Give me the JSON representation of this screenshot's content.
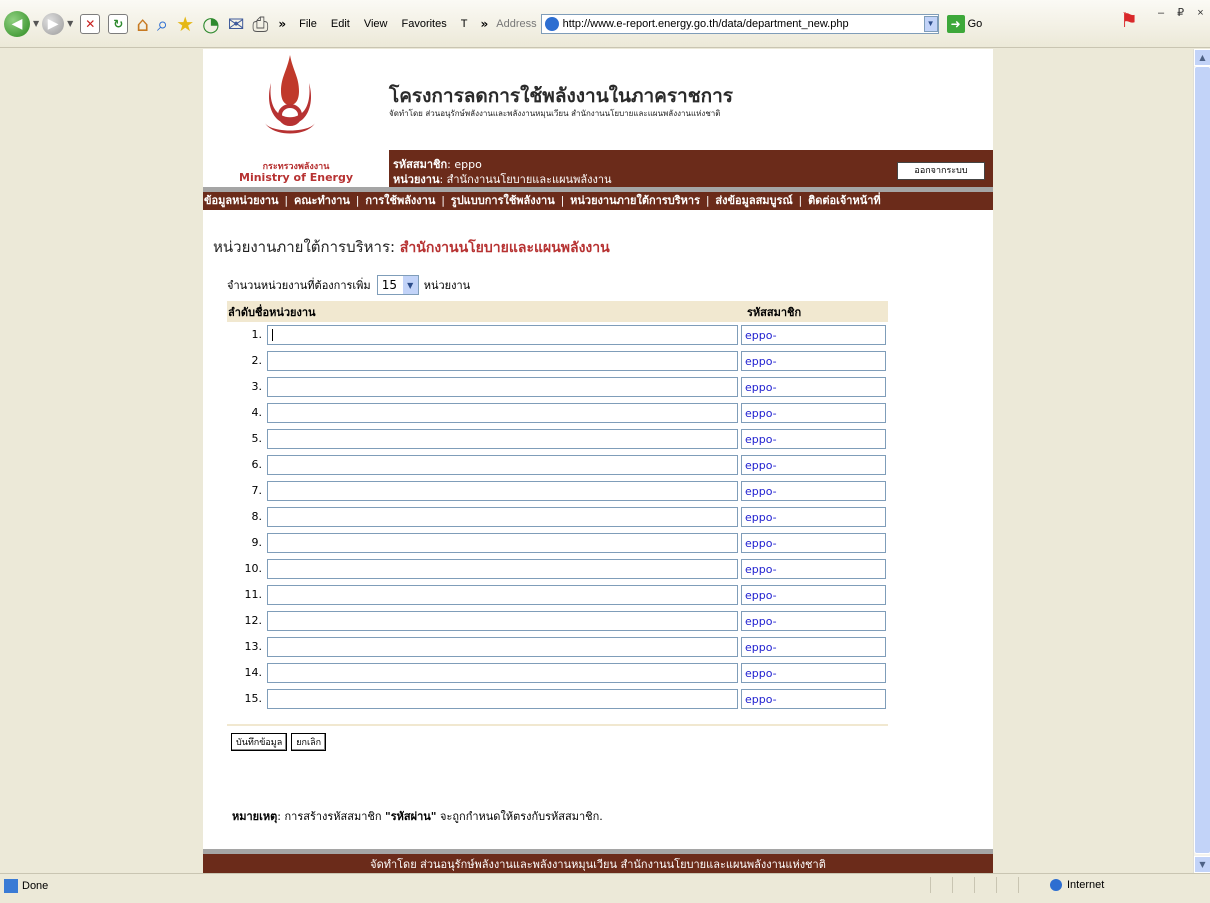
{
  "browser": {
    "menu": [
      "File",
      "Edit",
      "View",
      "Favorites",
      "T"
    ],
    "address_label": "Address",
    "url": "http://www.e-report.energy.go.th/data/department_new.php",
    "go_label": "Go",
    "window_controls": "– ₽ ×"
  },
  "header": {
    "title": "โครงการลดการใช้พลังงานในภาคราชการ",
    "subtitle": "จัดทำโดย ส่วนอนุรักษ์พลังงานและพลังงานหมุนเวียน สำนักงานนโยบายและแผนพลังงานแห่งชาติ",
    "ministry_th": "กระทรวงพลังงาน",
    "ministry_en": "Ministry of Energy"
  },
  "user": {
    "member_label": "รหัสสมาชิก",
    "member_value": ": eppo",
    "unit_label": "หน่วยงาน",
    "unit_value": ": สำนักงานนโยบายและแผนพลังงาน",
    "logout_label": "ออกจากระบบ"
  },
  "nav": {
    "items": [
      "ข้อมูลหน่วยงาน",
      "คณะทำงาน",
      "การใช้พลังงาน",
      "รูปแบบการใช้พลังงาน",
      "หน่วยงานภายใต้การบริหาร",
      "ส่งข้อมูลสมบูรณ์",
      "ติดต่อเจ้าหน้าที่"
    ],
    "separator": "|"
  },
  "section": {
    "title_prefix": "หน่วยงานภายใต้การบริหาร:",
    "title_unit": "สำนักงานนโยบายและแผนพลังงาน",
    "count_label": "จำนวนหน่วยงานที่ต้องการเพิ่ม",
    "count_value": "15",
    "count_unit": "หน่วยงาน"
  },
  "table": {
    "col_no": "ลำดับ",
    "col_name": "ชื่อหน่วยงาน",
    "col_code": "รหัสสมาชิก",
    "rows": [
      {
        "no": "1.",
        "name": "",
        "code": "eppo-"
      },
      {
        "no": "2.",
        "name": "",
        "code": "eppo-"
      },
      {
        "no": "3.",
        "name": "",
        "code": "eppo-"
      },
      {
        "no": "4.",
        "name": "",
        "code": "eppo-"
      },
      {
        "no": "5.",
        "name": "",
        "code": "eppo-"
      },
      {
        "no": "6.",
        "name": "",
        "code": "eppo-"
      },
      {
        "no": "7.",
        "name": "",
        "code": "eppo-"
      },
      {
        "no": "8.",
        "name": "",
        "code": "eppo-"
      },
      {
        "no": "9.",
        "name": "",
        "code": "eppo-"
      },
      {
        "no": "10.",
        "name": "",
        "code": "eppo-"
      },
      {
        "no": "11.",
        "name": "",
        "code": "eppo-"
      },
      {
        "no": "12.",
        "name": "",
        "code": "eppo-"
      },
      {
        "no": "13.",
        "name": "",
        "code": "eppo-"
      },
      {
        "no": "14.",
        "name": "",
        "code": "eppo-"
      },
      {
        "no": "15.",
        "name": "",
        "code": "eppo-"
      }
    ]
  },
  "buttons": {
    "save": "บันทึกข้อมูล",
    "cancel": "ยกเลิก"
  },
  "note": {
    "label": "หมายเหตุ",
    "text_before": ": การสร้างรหัสสมาชิก ",
    "highlight": "\"รหัสผ่าน\"",
    "text_after": " จะถูกกำหนดให้ตรงกับรหัสสมาชิก."
  },
  "footer": {
    "text": "จัดทำโดย ส่วนอนุรักษ์พลังงานและพลังงานหมุนเวียน สำนักงานนโยบายและแผนพลังงานแห่งชาติ"
  },
  "status": {
    "left": "Done",
    "zone": "Internet"
  },
  "colors": {
    "brand": "#6b2b1a",
    "accent_red": "#b73232",
    "table_header": "#f1e8d0",
    "link_blue": "#2020d0"
  },
  "icons": [
    "back-icon",
    "forward-icon",
    "stop-icon",
    "refresh-icon",
    "home-icon",
    "search-icon",
    "favorites-icon",
    "history-icon",
    "mail-icon",
    "print-icon"
  ]
}
